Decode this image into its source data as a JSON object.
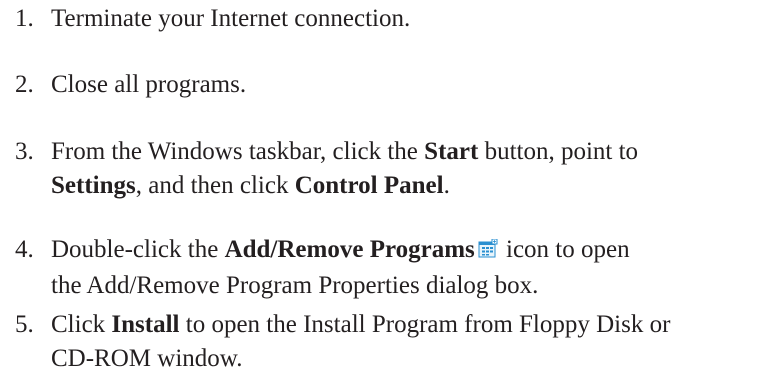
{
  "steps": [
    {
      "num": "1.",
      "text": "Terminate your Internet connection."
    },
    {
      "num": "2.",
      "text": "Close all programs."
    },
    {
      "num": "3.",
      "t1": "From the Windows taskbar, click the ",
      "b1": "Start",
      "t2": " button, point to",
      "b2": "Settings",
      "t3": ", and then click ",
      "b3": "Control Panel",
      "t4": "."
    },
    {
      "num": "4.",
      "t1": "Double-click the ",
      "b1": "Add/Remove Programs",
      "t2": " icon to open",
      "t3": "the Add/Remove Program Properties dialog box.",
      "icon": "add-remove-programs-icon"
    },
    {
      "num": "5.",
      "t1": "Click ",
      "b1": "Install",
      "t2": " to open the Install Program from Floppy Disk or",
      "t3": "CD-ROM window."
    }
  ]
}
